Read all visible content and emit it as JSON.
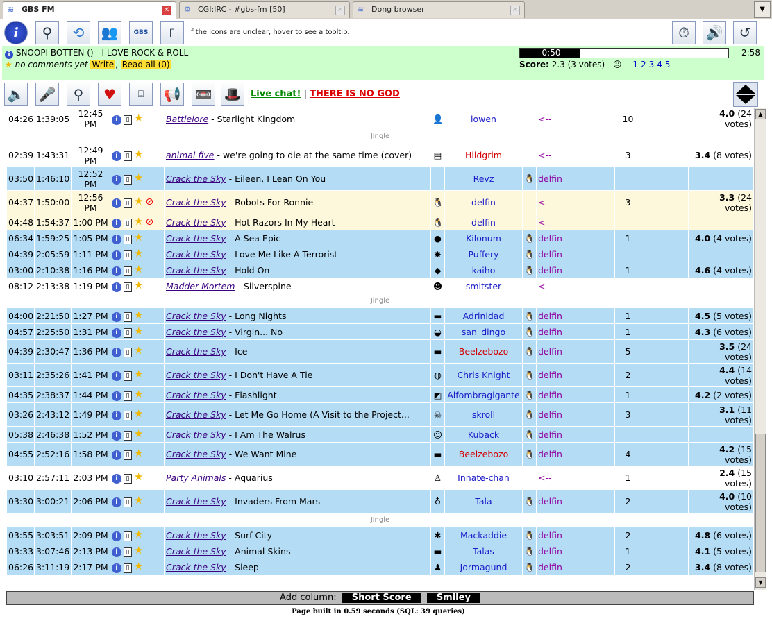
{
  "tabs": [
    {
      "label": "GBS FM",
      "active": true
    },
    {
      "label": "CGI:IRC - #gbs-fm [50]",
      "active": false
    },
    {
      "label": "Dong browser",
      "active": false
    }
  ],
  "toolbar": {
    "hint": "If the icons are unclear, hover to see a tooltip.",
    "logo_text": "GBS FM"
  },
  "now_playing": {
    "title": "SNOOPI BOTTEN () - I LOVE ROCK & ROLL",
    "comments": "no comments yet",
    "write": "Write",
    "read_all": "Read all (0)",
    "elapsed": "0:50",
    "progress_fraction": 0.2874,
    "duration": "2:58",
    "score_label": "Score:",
    "score_value": "2.3 (3 votes)",
    "vote_links": [
      "1",
      "2",
      "3",
      "4",
      "5"
    ]
  },
  "links": {
    "live_chat": "Live chat!",
    "separator": "|",
    "no_god": "THERE IS NO GOD"
  },
  "playlist": [
    {
      "dur": "04:26",
      "tot": "1:39:05",
      "time": "12:45 PM",
      "artist": "Battlelore",
      "title": "Starlight Kingdom",
      "av": "👤",
      "user": "lowen",
      "red": false,
      "u2": "",
      "arr": "<--",
      "cnt": "10",
      "score": "4.0",
      "votes": "(24 votes)",
      "cls": "c0",
      "nb": false,
      "tall": false
    },
    {
      "jingle": "Jingle"
    },
    {
      "dur": "02:39",
      "tot": "1:43:31",
      "time": "12:49 PM",
      "artist": "animal five",
      "title": "we're going to die at the same time (cover)",
      "av": "▤",
      "user": "Hildgrim",
      "red": true,
      "u2": "",
      "arr": "<--",
      "cnt": "3",
      "score": "3.4",
      "votes": "(8 votes)",
      "cls": "c0",
      "nb": false,
      "tall": true
    },
    {
      "dur": "03:50",
      "tot": "1:46:10",
      "time": "12:52 PM",
      "artist": "Crack the Sky",
      "title": "Eileen, I Lean On You",
      "av": "",
      "user": "Revz",
      "red": false,
      "u2": "delfin",
      "arr": "",
      "cnt": "",
      "score": "",
      "votes": "",
      "cls": "c1",
      "nb": false,
      "tall": true
    },
    {
      "dur": "04:37",
      "tot": "1:50:00",
      "time": "12:56 PM",
      "artist": "Crack the Sky",
      "title": "Robots For Ronnie",
      "av": "🐧",
      "user": "delfin",
      "red": false,
      "u2": "",
      "arr": "<--",
      "cnt": "3",
      "score": "3.3",
      "votes": "(24 votes)",
      "cls": "c2",
      "nb": true,
      "tall": true
    },
    {
      "dur": "04:48",
      "tot": "1:54:37",
      "time": "1:00 PM",
      "artist": "Crack the Sky",
      "title": "Hot Razors In My Heart",
      "av": "🐧",
      "user": "delfin",
      "red": false,
      "u2": "",
      "arr": "<--",
      "cnt": "",
      "score": "",
      "votes": "",
      "cls": "c2",
      "nb": true,
      "tall": false
    },
    {
      "dur": "06:34",
      "tot": "1:59:25",
      "time": "1:05 PM",
      "artist": "Crack the Sky",
      "title": "A Sea Epic",
      "av": "●",
      "user": "Kilonum",
      "red": false,
      "u2": "delfin",
      "arr": "",
      "cnt": "1",
      "score": "4.0",
      "votes": "(4 votes)",
      "cls": "c1",
      "nb": false,
      "tall": false
    },
    {
      "dur": "04:39",
      "tot": "2:05:59",
      "time": "1:11 PM",
      "artist": "Crack the Sky",
      "title": "Love Me Like A Terrorist",
      "av": "✸",
      "user": "Puffery",
      "red": false,
      "u2": "delfin",
      "arr": "",
      "cnt": "",
      "score": "",
      "votes": "",
      "cls": "c1",
      "nb": false,
      "tall": false
    },
    {
      "dur": "03:00",
      "tot": "2:10:38",
      "time": "1:16 PM",
      "artist": "Crack the Sky",
      "title": "Hold On",
      "av": "◆",
      "user": "kaiho",
      "red": false,
      "u2": "delfin",
      "arr": "",
      "cnt": "1",
      "score": "4.6",
      "votes": "(4 votes)",
      "cls": "c1",
      "nb": false,
      "tall": false
    },
    {
      "dur": "08:12",
      "tot": "2:13:38",
      "time": "1:19 PM",
      "artist": "Madder Mortem",
      "title": "Silverspine",
      "av": "☻",
      "user": "smitster",
      "red": false,
      "u2": "",
      "arr": "<--",
      "cnt": "",
      "score": "",
      "votes": "",
      "cls": "c0",
      "nb": false,
      "tall": false
    },
    {
      "jingle": "Jingle"
    },
    {
      "dur": "04:00",
      "tot": "2:21:50",
      "time": "1:27 PM",
      "artist": "Crack the Sky",
      "title": "Long Nights",
      "av": "▬",
      "user": "Adrinidad",
      "red": false,
      "u2": "delfin",
      "arr": "",
      "cnt": "1",
      "score": "4.5",
      "votes": "(5 votes)",
      "cls": "c1",
      "nb": false,
      "tall": false
    },
    {
      "dur": "04:57",
      "tot": "2:25:50",
      "time": "1:31 PM",
      "artist": "Crack the Sky",
      "title": "Virgin... No",
      "av": "◒",
      "user": "san_dingo",
      "red": false,
      "u2": "delfin",
      "arr": "",
      "cnt": "1",
      "score": "4.3",
      "votes": "(6 votes)",
      "cls": "c1",
      "nb": false,
      "tall": false
    },
    {
      "dur": "04:39",
      "tot": "2:30:47",
      "time": "1:36 PM",
      "artist": "Crack the Sky",
      "title": "Ice",
      "av": "▬",
      "user": "Beelzebozo",
      "red": true,
      "u2": "delfin",
      "arr": "",
      "cnt": "5",
      "score": "3.5",
      "votes": "(24 votes)",
      "cls": "c1",
      "nb": false,
      "tall": true
    },
    {
      "dur": "03:11",
      "tot": "2:35:26",
      "time": "1:41 PM",
      "artist": "Crack the Sky",
      "title": "I Don't Have A Tie",
      "av": "◍",
      "user": "Chris Knight",
      "red": false,
      "u2": "delfin",
      "arr": "",
      "cnt": "2",
      "score": "4.4",
      "votes": "(14 votes)",
      "cls": "c1",
      "nb": false,
      "tall": true
    },
    {
      "dur": "04:35",
      "tot": "2:38:37",
      "time": "1:44 PM",
      "artist": "Crack the Sky",
      "title": "Flashlight",
      "av": "◩",
      "user": "Alfombragigante",
      "red": false,
      "u2": "delfin",
      "arr": "",
      "cnt": "1",
      "score": "4.2",
      "votes": "(2 votes)",
      "cls": "c1",
      "nb": false,
      "tall": false
    },
    {
      "dur": "03:26",
      "tot": "2:43:12",
      "time": "1:49 PM",
      "artist": "Crack the Sky",
      "title": "Let Me Go Home (A Visit to the Project...",
      "av": "☠",
      "user": "skroll",
      "red": false,
      "u2": "delfin",
      "arr": "",
      "cnt": "3",
      "score": "3.1",
      "votes": "(11 votes)",
      "cls": "c1",
      "nb": false,
      "tall": true
    },
    {
      "dur": "05:38",
      "tot": "2:46:38",
      "time": "1:52 PM",
      "artist": "Crack the Sky",
      "title": "I Am The Walrus",
      "av": "☺",
      "user": "Kuback",
      "red": false,
      "u2": "delfin",
      "arr": "",
      "cnt": "",
      "score": "",
      "votes": "",
      "cls": "c1",
      "nb": false,
      "tall": false
    },
    {
      "dur": "04:55",
      "tot": "2:52:16",
      "time": "1:58 PM",
      "artist": "Crack the Sky",
      "title": "We Want Mine",
      "av": "▬",
      "user": "Beelzebozo",
      "red": true,
      "u2": "delfin",
      "arr": "",
      "cnt": "4",
      "score": "4.2",
      "votes": "(15 votes)",
      "cls": "c1",
      "nb": false,
      "tall": true
    },
    {
      "dur": "03:10",
      "tot": "2:57:11",
      "time": "2:03 PM",
      "artist": "Party Animals",
      "title": "Aquarius",
      "av": "♙",
      "user": "Innate-chan",
      "red": false,
      "u2": "",
      "arr": "<--",
      "cnt": "1",
      "score": "2.4",
      "votes": "(15 votes)",
      "cls": "c0",
      "nb": false,
      "tall": true
    },
    {
      "dur": "03:30",
      "tot": "3:00:21",
      "time": "2:06 PM",
      "artist": "Crack the Sky",
      "title": "Invaders From Mars",
      "av": "♁",
      "user": "Tala",
      "red": false,
      "u2": "delfin",
      "arr": "",
      "cnt": "2",
      "score": "4.0",
      "votes": "(10 votes)",
      "cls": "c1",
      "nb": false,
      "tall": true
    },
    {
      "jingle": "Jingle"
    },
    {
      "dur": "03:55",
      "tot": "3:03:51",
      "time": "2:09 PM",
      "artist": "Crack the Sky",
      "title": "Surf City",
      "av": "✱",
      "user": "Mackaddie",
      "red": false,
      "u2": "delfin",
      "arr": "",
      "cnt": "2",
      "score": "4.8",
      "votes": "(6 votes)",
      "cls": "c1",
      "nb": false,
      "tall": false
    },
    {
      "dur": "03:33",
      "tot": "3:07:46",
      "time": "2:13 PM",
      "artist": "Crack the Sky",
      "title": "Animal Skins",
      "av": "▬",
      "user": "Talas",
      "red": false,
      "u2": "delfin",
      "arr": "",
      "cnt": "1",
      "score": "4.1",
      "votes": "(5 votes)",
      "cls": "c1",
      "nb": false,
      "tall": false
    },
    {
      "dur": "06:26",
      "tot": "3:11:19",
      "time": "2:17 PM",
      "artist": "Crack the Sky",
      "title": "Sleep",
      "av": "♟",
      "user": "Jormagund",
      "red": false,
      "u2": "delfin",
      "arr": "",
      "cnt": "2",
      "score": "3.4",
      "votes": "(8 votes)",
      "cls": "c1",
      "nb": false,
      "tall": false
    }
  ],
  "add_column": {
    "label": "Add column:",
    "buttons": [
      "Short Score",
      "Smiley"
    ]
  },
  "footer": "Page built in 0.59 seconds (SQL: 39 queries)"
}
